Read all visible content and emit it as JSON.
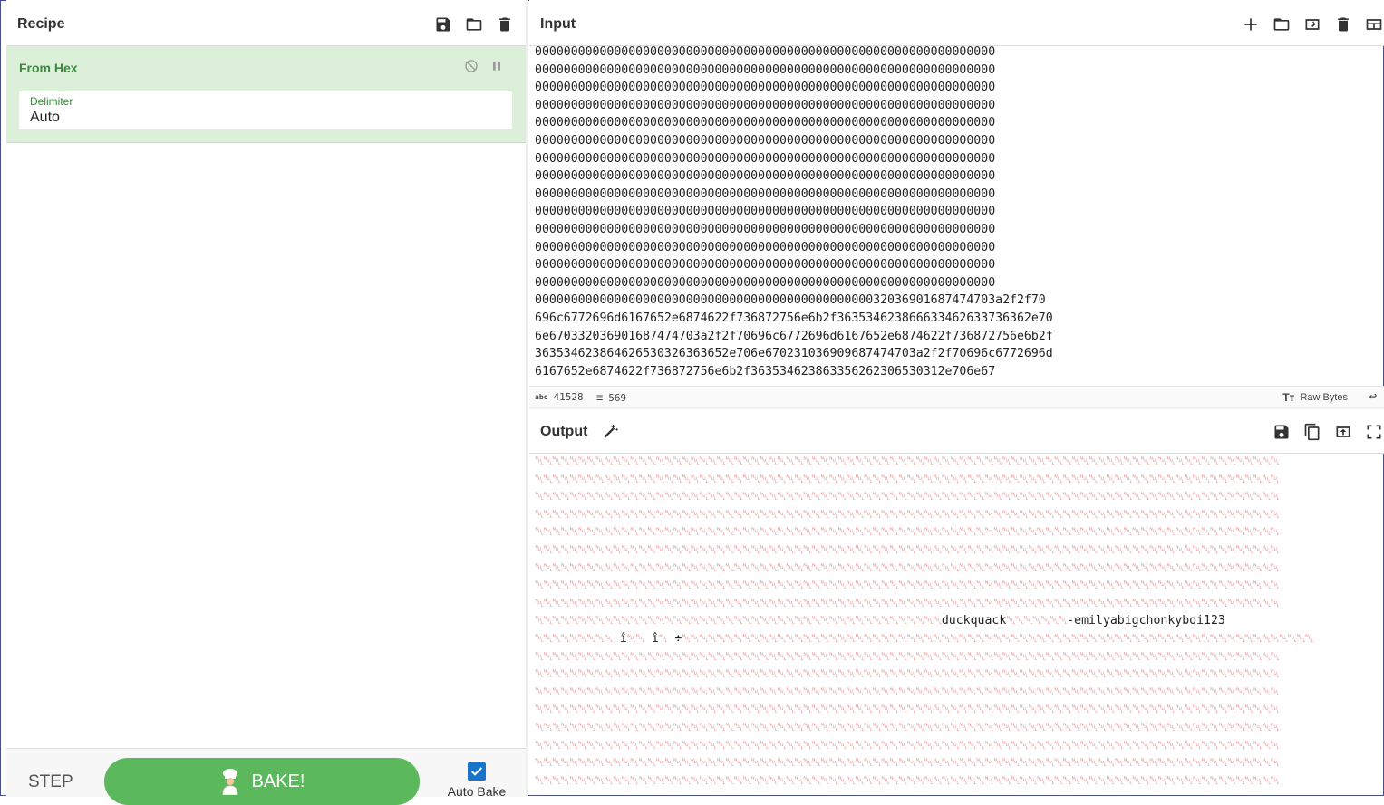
{
  "recipe": {
    "title": "Recipe",
    "operation": {
      "name": "From Hex",
      "delimiter_label": "Delimiter",
      "delimiter_value": "Auto"
    },
    "step_label": "STEP",
    "bake_label": "BAKE!",
    "auto_bake_label": "Auto Bake",
    "auto_bake_checked": true
  },
  "input": {
    "title": "Input",
    "lines": [
      "0000000000000000000000000000000000000000000000000000000000000000",
      "0000000000000000000000000000000000000000000000000000000000000000",
      "0000000000000000000000000000000000000000000000000000000000000000",
      "0000000000000000000000000000000000000000000000000000000000000000",
      "0000000000000000000000000000000000000000000000000000000000000000",
      "0000000000000000000000000000000000000000000000000000000000000000",
      "0000000000000000000000000000000000000000000000000000000000000000",
      "0000000000000000000000000000000000000000000000000000000000000000",
      "0000000000000000000000000000000000000000000000000000000000000000",
      "0000000000000000000000000000000000000000000000000000000000000000",
      "0000000000000000000000000000000000000000000000000000000000000000",
      "0000000000000000000000000000000000000000000000000000000000000000",
      "0000000000000000000000000000000000000000000000000000000000000000",
      "0000000000000000000000000000000000000000000000000000000000000000",
      "000000000000000000000000000000000000000000000003203690168747470 3a2f2f70",
      "696c6772696d6167652e6874622f736872756e6b2f36353462386663346263373 6362e70",
      "6e67033203690168747470 3a2f2f70696c6772696d6167652e6874622f736872756e6b2f",
      "36353462386462653032636 3652e706e67023103690968747470 3a2f2f70696c6772696d",
      "6167652e6874622f736872756e6b2f363534623863356 2623065303 12e706e67"
    ],
    "char_count": "41528",
    "line_count": "569",
    "encoding_label": "Raw Bytes"
  },
  "output": {
    "title": "Output",
    "control_row": "␀␀␀␀␀␀␀␀␀␀␀␀␀␀␀␀␀␀␀␀␀␀␀␀␀␀␀␀␀␀␀␀␀␀␀␀␀␀␀␀␀␀␀␀␀␀␀␀␀␀␀␀␀␀␀␀␀␀␀␀␀␀␀␀␀␀␀␀␀␀␀␀␀␀␀␀␀␀␀␀␀␀␀␀␀␀",
    "highlight_line": {
      "prefix": "␀␀␀␀␀␀␀␀␀␀␀␀␀␀␀␀␀␀␀␀␀␀␀␀␀␀␀␀␀␀␀␀␀␀␀␀␀␀␀␀␀␀␀␀␀␀␀",
      "text1": "duckquack",
      "mid": "␀␀␀␀␀␀␀",
      "text2": "-emilyabigchonkyboi123"
    },
    "second_line": {
      "prefix": "␀␀␀␀␀␀␀␀␀",
      "c1": " î",
      "mid1": "␀␀",
      "c2": " î",
      "mid2": "␀",
      "c3": " ÷",
      "tail": "␀␀␀␀␀␀␀␀␀␀␀␀␀␀␀␀␀␀␀␀␀␀␀␀␀␀␀␀␀␀␀␀␀␀␀␀␀␀␀␀␀␀␀␀␀␀␀␀␀␀␀␀␀␀␀␀␀␀␀␀␀␀␀␀␀␀␀␀␀␀␀␀␀"
    }
  },
  "icons": {
    "recipe": [
      "save-icon",
      "folder-icon",
      "trash-icon"
    ],
    "input": [
      "plus-icon",
      "folder-icon",
      "import-icon",
      "trash-icon",
      "layout-icon"
    ],
    "output": [
      "save-icon",
      "copy-icon",
      "replace-input-icon",
      "maximize-icon"
    ]
  },
  "colors": {
    "accent": "#5cb85c",
    "op_bg": "#dcefd8",
    "control_char": "#e27a7a"
  }
}
